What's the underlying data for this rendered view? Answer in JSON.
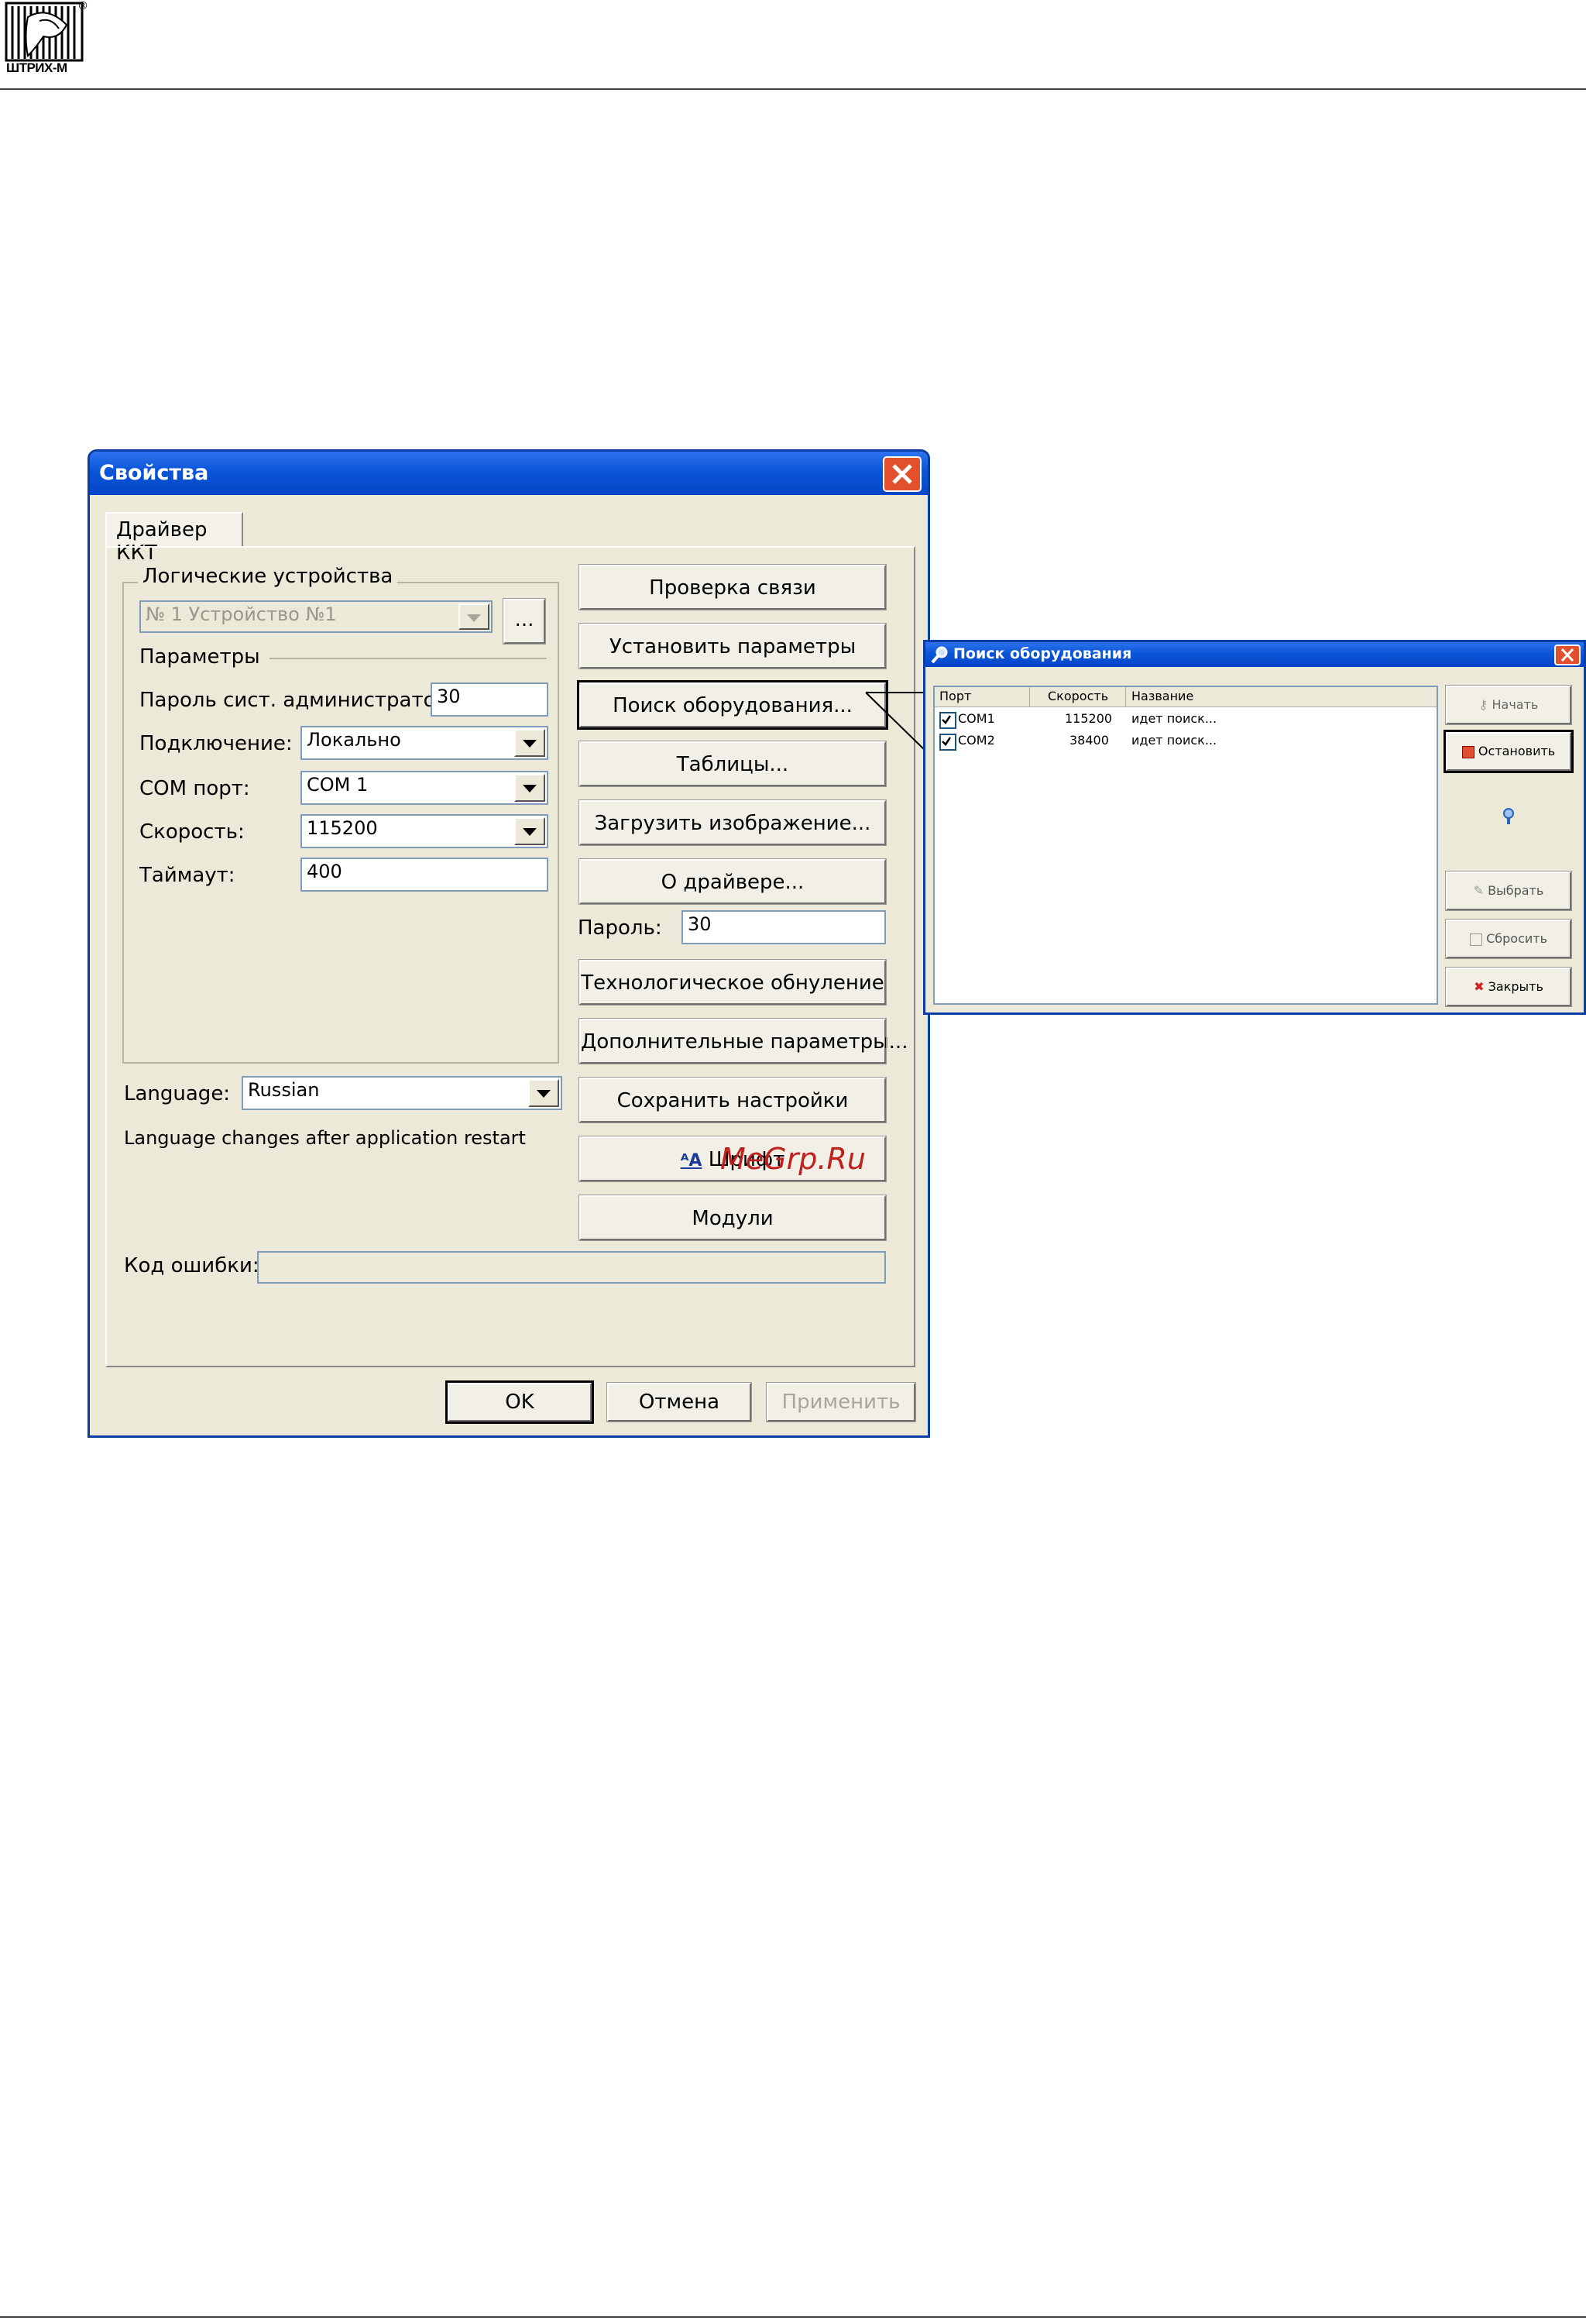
{
  "header": {
    "logo_text": "ШТРИХ-М",
    "registered_mark": "®"
  },
  "props_window": {
    "title": "Свойства",
    "tab": "Драйвер ККТ",
    "group_logical": "Логические устройства",
    "device_value": "№ 1 Устройство №1",
    "browse_label": "...",
    "params_title": "Параметры",
    "admin_password_label": "Пароль сист. администратора",
    "admin_password_value": "30",
    "connection_label": "Подключение:",
    "connection_value": "Локально",
    "com_port_label": "COM порт:",
    "com_port_value": "COM 1",
    "speed_label": "Скорость:",
    "speed_value": "115200",
    "timeout_label": "Таймаут:",
    "timeout_value": "400",
    "language_label": "Language:",
    "language_value": "Russian",
    "language_note": "Language changes after application restart",
    "buttons": {
      "check": "Проверка связи",
      "set_params": "Установить параметры",
      "search": "Поиск оборудования...",
      "tables": "Таблицы...",
      "load_image": "Загрузить изображение...",
      "about": "О драйвере...",
      "tech_reset": "Технологическое обнуление",
      "extra_params": "Дополнительные параметры...",
      "save": "Сохранить настройки",
      "font": "Шрифт",
      "modules": "Модули"
    },
    "password_label": "Пароль:",
    "password_value": "30",
    "error_code_label": "Код ошибки:",
    "error_code_value": "",
    "ok": "OK",
    "cancel": "Отмена",
    "apply": "Применить"
  },
  "search_window": {
    "title": "Поиск оборудования",
    "columns": [
      "Порт",
      "Скорость",
      "Название"
    ],
    "rows": [
      {
        "port": "COM1",
        "speed": "115200",
        "name": "идет поиск..."
      },
      {
        "port": "COM2",
        "speed": "38400",
        "name": "идет поиск..."
      }
    ],
    "buttons": {
      "start": "Начать",
      "stop": "Остановить",
      "select": "Выбрать",
      "reset": "Сбросить",
      "close": "Закрыть"
    }
  },
  "watermark": "MeGrp.Ru",
  "colors": {
    "titlebar": "#0a56d8",
    "close": "#e2502e",
    "dialog_bg": "#ece9d8",
    "watermark": "#c0201e"
  }
}
